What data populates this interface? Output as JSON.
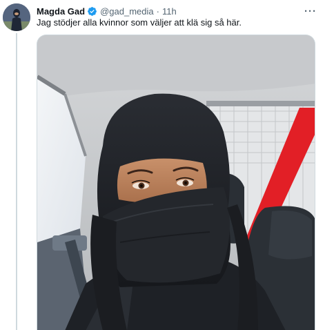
{
  "tweet": {
    "author": {
      "display_name": "Magda Gad",
      "handle": "@gad_media",
      "verified": true,
      "avatar_icon": "profile-avatar"
    },
    "separator": "·",
    "timestamp": "11h",
    "more_icon": "more-horizontal-icon",
    "more_label": "···",
    "text": "Jag stödjer alla kvinnor som väljer att klä sig så här.",
    "media": {
      "kind": "photo",
      "alt": ""
    },
    "colors": {
      "verified_badge": "#1d9bf0",
      "secondary_text": "#536471",
      "thread_line": "#cfd9de"
    }
  }
}
